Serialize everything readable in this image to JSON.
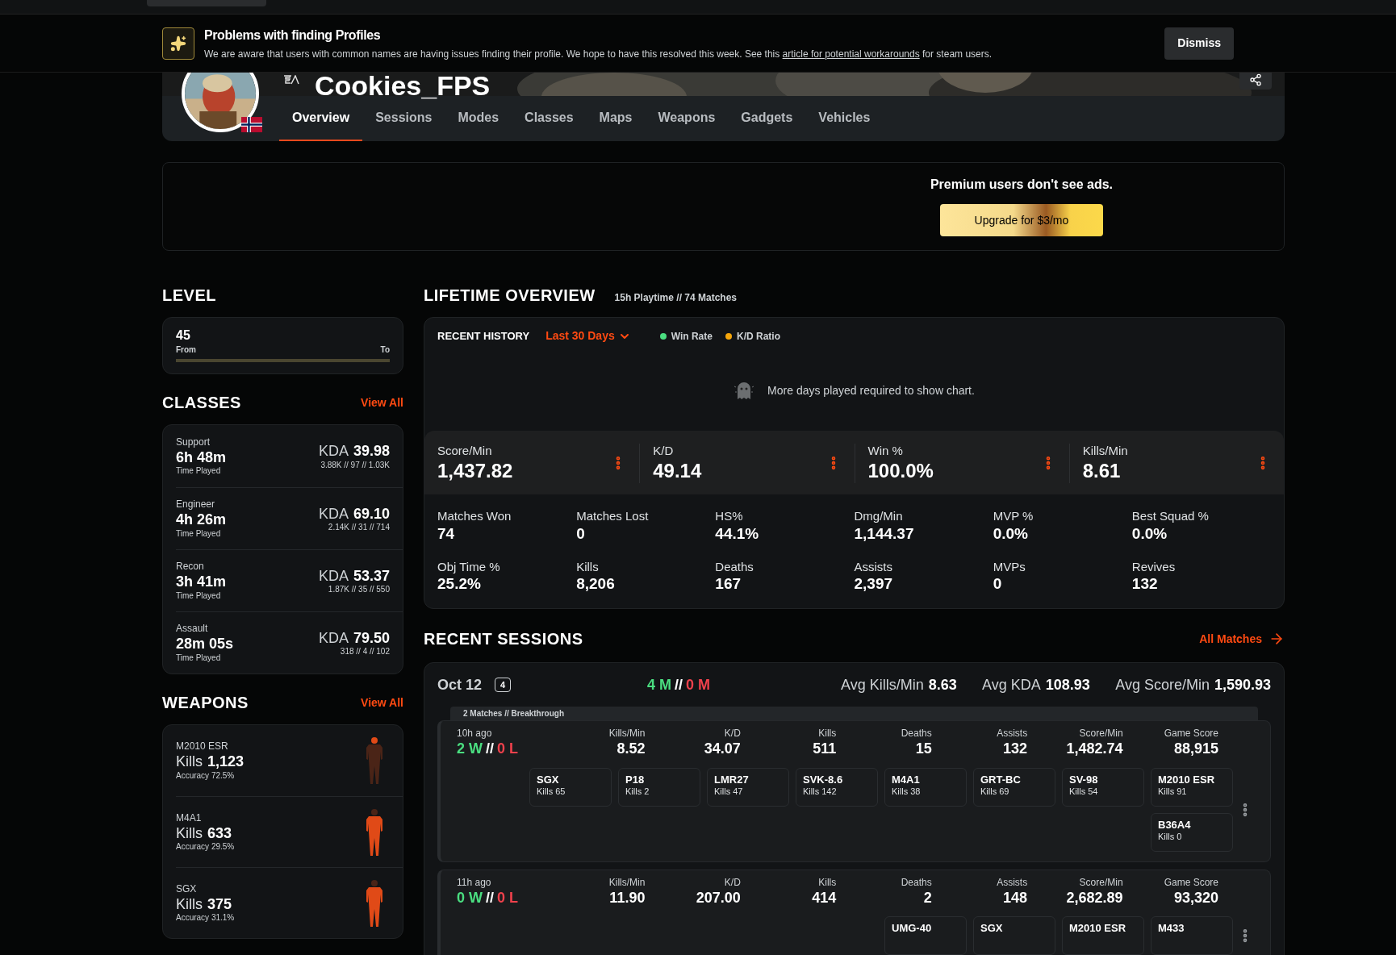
{
  "notice": {
    "title": "Problems with finding Profiles",
    "text_before": "We are aware that users with common names are having issues finding their profile. We hope to have this resolved this week. See this",
    "link": "article for potential workarounds",
    "text_after": "for steam users.",
    "dismiss": "Dismiss"
  },
  "profile": {
    "name": "Cookies_FPS"
  },
  "tabs": [
    {
      "label": "Overview",
      "selected": true
    },
    {
      "label": "Sessions",
      "selected": false
    },
    {
      "label": "Modes",
      "selected": false
    },
    {
      "label": "Classes",
      "selected": false
    },
    {
      "label": "Maps",
      "selected": false
    },
    {
      "label": "Weapons",
      "selected": false
    },
    {
      "label": "Gadgets",
      "selected": false
    },
    {
      "label": "Vehicles",
      "selected": false
    }
  ],
  "ad": {
    "text": "Premium users don't see ads.",
    "button": "Upgrade for $3/mo"
  },
  "level": {
    "title": "LEVEL",
    "value": "45",
    "from": "From",
    "to": "To"
  },
  "classes": {
    "title": "CLASSES",
    "view_all": "View All",
    "items": [
      {
        "name": "Support",
        "time": "6h 48m",
        "time_label": "Time Played",
        "kda_label": "KDA",
        "kda": "39.98",
        "breakdown": "3.88K // 97 // 1.03K"
      },
      {
        "name": "Engineer",
        "time": "4h 26m",
        "time_label": "Time Played",
        "kda_label": "KDA",
        "kda": "69.10",
        "breakdown": "2.14K // 31 // 714"
      },
      {
        "name": "Recon",
        "time": "3h 41m",
        "time_label": "Time Played",
        "kda_label": "KDA",
        "kda": "53.37",
        "breakdown": "1.87K // 35 // 550"
      },
      {
        "name": "Assault",
        "time": "28m 05s",
        "time_label": "Time Played",
        "kda_label": "KDA",
        "kda": "79.50",
        "breakdown": "318 // 4 // 102"
      }
    ]
  },
  "weapons": {
    "title": "WEAPONS",
    "view_all": "View All",
    "items": [
      {
        "name": "M2010 ESR",
        "kills_label": "Kills",
        "kills": "1,123",
        "accuracy": "Accuracy 72.5%",
        "color": "#4a2417"
      },
      {
        "name": "M4A1",
        "kills_label": "Kills",
        "kills": "633",
        "accuracy": "Accuracy 29.5%",
        "color": "#e04a17"
      },
      {
        "name": "SGX",
        "kills_label": "Kills",
        "kills": "375",
        "accuracy": "Accuracy 31.1%",
        "color": "#e04a17"
      }
    ]
  },
  "lifetime": {
    "title": "LIFETIME OVERVIEW",
    "subtitle": "15h Playtime // 74 Matches",
    "history": {
      "title": "RECENT HISTORY",
      "range": "Last 30 Days",
      "legend": [
        {
          "label": "Win Rate",
          "color": "#4ade80"
        },
        {
          "label": "K/D Ratio",
          "color": "#f5a60b"
        }
      ],
      "message": "More days played required to show chart."
    },
    "main_stats": [
      {
        "label": "Score/Min",
        "value": "1,437.82"
      },
      {
        "label": "K/D",
        "value": "49.14"
      },
      {
        "label": "Win %",
        "value": "100.0%"
      },
      {
        "label": "Kills/Min",
        "value": "8.61"
      }
    ],
    "stats": [
      {
        "label": "Matches Won",
        "value": "74"
      },
      {
        "label": "Matches Lost",
        "value": "0"
      },
      {
        "label": "HS%",
        "value": "44.1%"
      },
      {
        "label": "Dmg/Min",
        "value": "1,144.37"
      },
      {
        "label": "MVP %",
        "value": "0.0%"
      },
      {
        "label": "Best Squad %",
        "value": "0.0%"
      },
      {
        "label": "Obj Time %",
        "value": "25.2%"
      },
      {
        "label": "Kills",
        "value": "8,206"
      },
      {
        "label": "Deaths",
        "value": "167"
      },
      {
        "label": "Assists",
        "value": "2,397"
      },
      {
        "label": "MVPs",
        "value": "0"
      },
      {
        "label": "Revives",
        "value": "132"
      }
    ]
  },
  "sessions": {
    "title": "RECENT SESSIONS",
    "all_matches": "All Matches",
    "day": {
      "date": "Oct 12",
      "count": "4",
      "wins": "4 M",
      "separator": "//",
      "losses": "0 M",
      "averages": [
        {
          "label": "Avg Kills/Min",
          "value": "8.63"
        },
        {
          "label": "Avg KDA",
          "value": "108.93"
        },
        {
          "label": "Avg Score/Min",
          "value": "1,590.93"
        }
      ],
      "group": "2 Matches // Breakthrough",
      "matches": [
        {
          "ago": "10h ago",
          "wins": "2 W",
          "separator": "//",
          "losses": "0 L",
          "stats": [
            {
              "label": "Kills/Min",
              "value": "8.52"
            },
            {
              "label": "K/D",
              "value": "34.07"
            },
            {
              "label": "Kills",
              "value": "511"
            },
            {
              "label": "Deaths",
              "value": "15"
            },
            {
              "label": "Assists",
              "value": "132"
            },
            {
              "label": "Score/Min",
              "value": "1,482.74"
            },
            {
              "label": "Game Score",
              "value": "88,915"
            }
          ],
          "weapons": [
            {
              "name": "SGX",
              "kills": "Kills 65"
            },
            {
              "name": "P18",
              "kills": "Kills 2"
            },
            {
              "name": "LMR27",
              "kills": "Kills 47"
            },
            {
              "name": "SVK-8.6",
              "kills": "Kills 142"
            },
            {
              "name": "M4A1",
              "kills": "Kills 38"
            },
            {
              "name": "GRT-BC",
              "kills": "Kills 69"
            },
            {
              "name": "SV-98",
              "kills": "Kills 54"
            },
            {
              "name": "M2010 ESR",
              "kills": "Kills 91"
            },
            {
              "name": "B36A4",
              "kills": "Kills 0"
            }
          ]
        },
        {
          "ago": "11h ago",
          "wins": "0 W",
          "separator": "//",
          "losses": "0 L",
          "stats": [
            {
              "label": "Kills/Min",
              "value": "11.90"
            },
            {
              "label": "K/D",
              "value": "207.00"
            },
            {
              "label": "Kills",
              "value": "414"
            },
            {
              "label": "Deaths",
              "value": "2"
            },
            {
              "label": "Assists",
              "value": "148"
            },
            {
              "label": "Score/Min",
              "value": "2,682.89"
            },
            {
              "label": "Game Score",
              "value": "93,320"
            }
          ],
          "weapons": [
            {
              "name": "UMG-40"
            },
            {
              "name": "SGX"
            },
            {
              "name": "M2010 ESR"
            },
            {
              "name": "M433"
            }
          ]
        }
      ]
    }
  }
}
